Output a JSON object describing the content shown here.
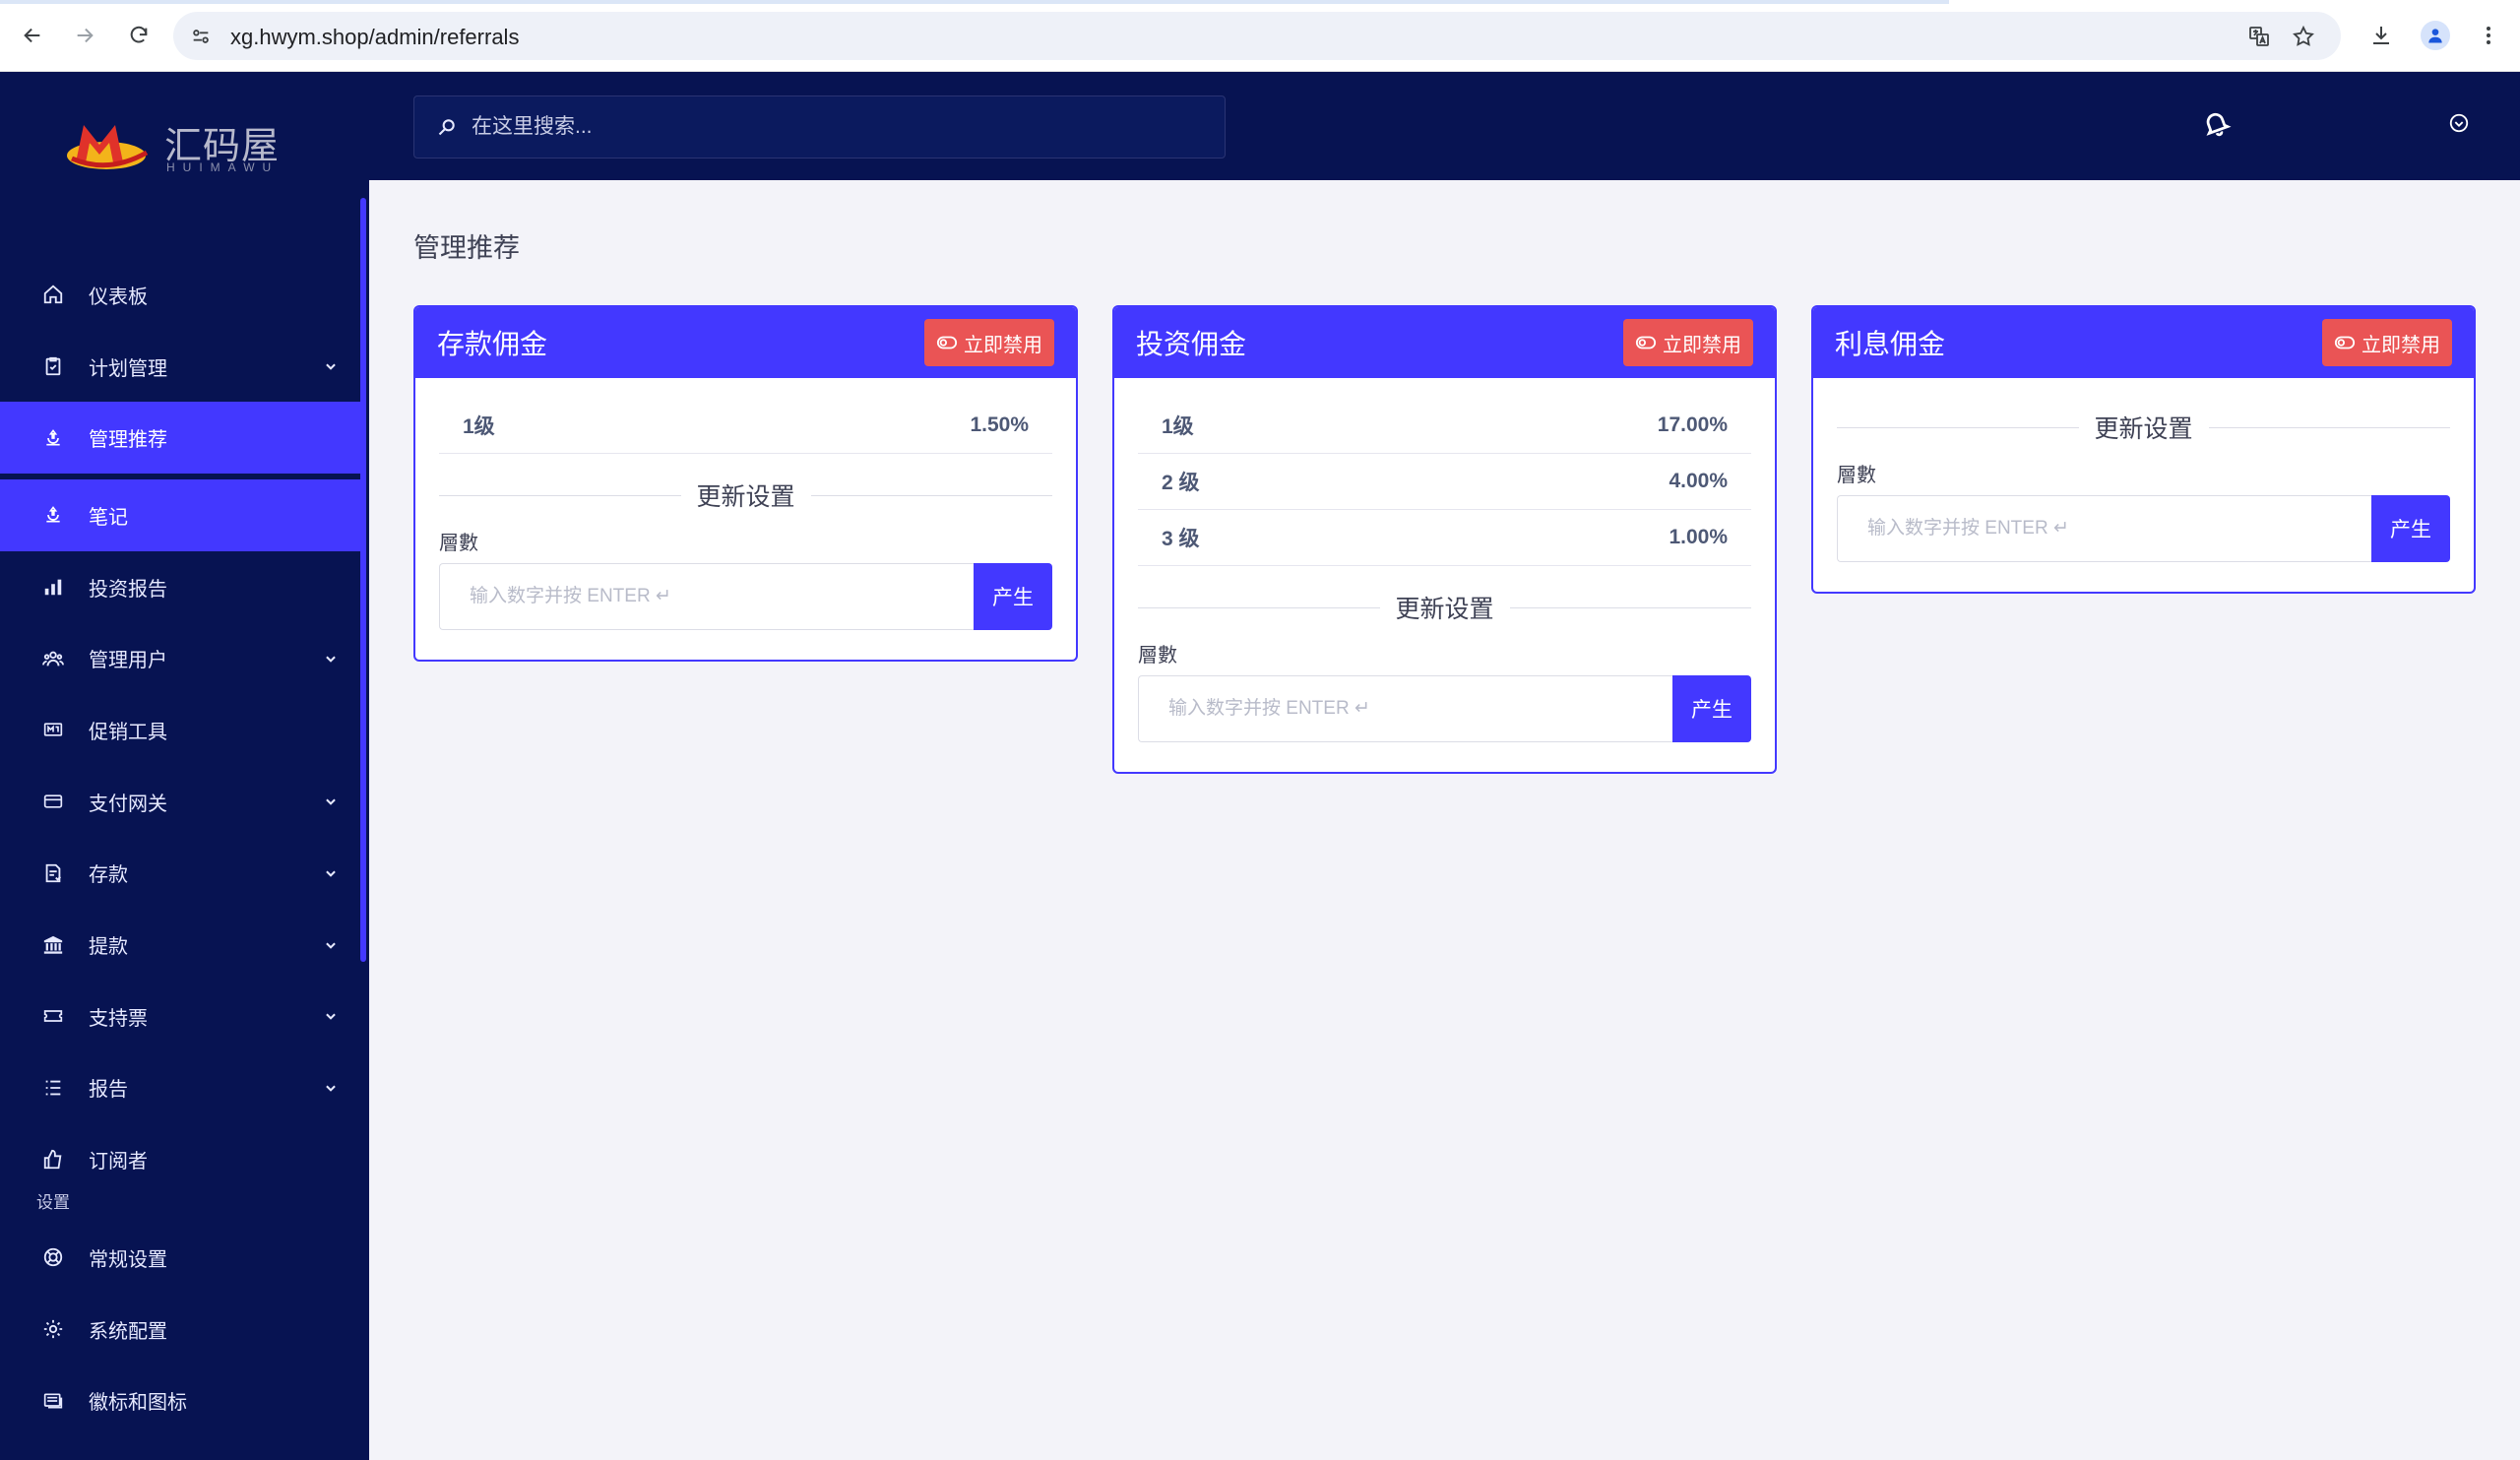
{
  "browser": {
    "url": "xg.hwym.shop/admin/referrals"
  },
  "logo": {
    "text": "汇码屋",
    "subtext": "HUIMAWU"
  },
  "search": {
    "placeholder": "在这里搜索..."
  },
  "sidebar": {
    "items": [
      {
        "label": "仪表板",
        "icon": "home-icon",
        "caret": false,
        "active": false
      },
      {
        "label": "计划管理",
        "icon": "clipboard-icon",
        "caret": true,
        "active": false
      },
      {
        "label": "管理推荐",
        "icon": "referral-icon",
        "caret": false,
        "active": true
      },
      {
        "label": "笔记",
        "icon": "referral-icon",
        "caret": false,
        "active": true
      },
      {
        "label": "投资报告",
        "icon": "bar-chart-icon",
        "caret": false,
        "active": false
      },
      {
        "label": "管理用户",
        "icon": "users-icon",
        "caret": true,
        "active": false
      },
      {
        "label": "促销工具",
        "icon": "promo-icon",
        "caret": false,
        "active": false
      },
      {
        "label": "支付网关",
        "icon": "credit-card-icon",
        "caret": true,
        "active": false
      },
      {
        "label": "存款",
        "icon": "deposit-icon",
        "caret": true,
        "active": false
      },
      {
        "label": "提款",
        "icon": "bank-icon",
        "caret": true,
        "active": false
      },
      {
        "label": "支持票",
        "icon": "ticket-icon",
        "caret": true,
        "active": false
      },
      {
        "label": "报告",
        "icon": "list-icon",
        "caret": true,
        "active": false
      },
      {
        "label": "订阅者",
        "icon": "thumbs-up-icon",
        "caret": false,
        "active": false
      }
    ],
    "section_label": "设置",
    "settings_items": [
      {
        "label": "常规设置",
        "icon": "lifebuoy-icon"
      },
      {
        "label": "系统配置",
        "icon": "gear-icon"
      },
      {
        "label": "徽标和图标",
        "icon": "image-icon"
      }
    ]
  },
  "page": {
    "title": "管理推荐"
  },
  "cards": [
    {
      "title": "存款佣金",
      "disable_label": "立即禁用",
      "levels": [
        {
          "level": "1级",
          "value": "1.50%"
        }
      ],
      "divider": "更新设置",
      "field_label": "層數",
      "input_placeholder": "输入数字并按 ENTER ↵",
      "generate_label": "产生"
    },
    {
      "title": "投资佣金",
      "disable_label": "立即禁用",
      "levels": [
        {
          "level": "1级",
          "value": "17.00%"
        },
        {
          "level": "2 级",
          "value": "4.00%"
        },
        {
          "level": "3 级",
          "value": "1.00%"
        }
      ],
      "divider": "更新设置",
      "field_label": "層數",
      "input_placeholder": "输入数字并按 ENTER ↵",
      "generate_label": "产生"
    },
    {
      "title": "利息佣金",
      "disable_label": "立即禁用",
      "levels": [],
      "divider": "更新设置",
      "field_label": "層數",
      "input_placeholder": "输入数字并按 ENTER ↵",
      "generate_label": "产生"
    }
  ],
  "colors": {
    "sidebar_bg": "#071352",
    "accent": "#4338ff",
    "danger": "#ea5455",
    "page_bg": "#f3f3f9"
  }
}
